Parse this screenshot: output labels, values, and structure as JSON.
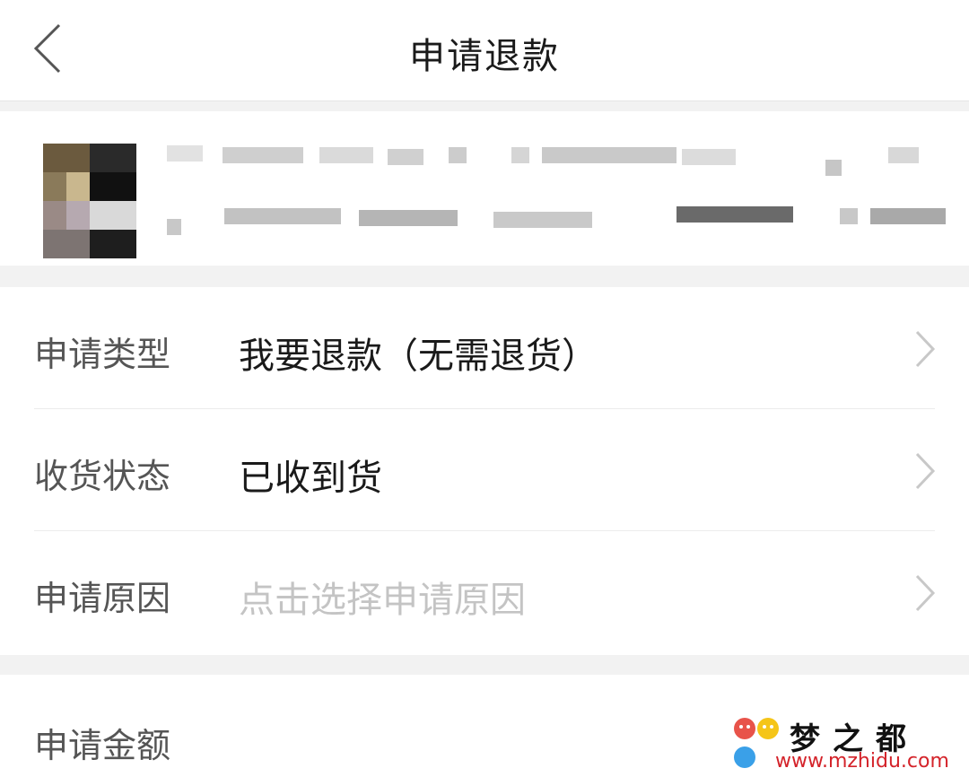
{
  "header": {
    "title": "申请退款"
  },
  "form": {
    "rows": [
      {
        "label": "申请类型",
        "value": "我要退款（无需退货）",
        "is_placeholder": false
      },
      {
        "label": "收货状态",
        "value": "已收到货",
        "is_placeholder": false
      },
      {
        "label": "申请原因",
        "value": "点击选择申请原因",
        "is_placeholder": true
      }
    ]
  },
  "amount": {
    "label": "申请金额"
  },
  "watermark": {
    "title": "梦之都",
    "url": "www.mzhidu.com"
  },
  "colors": {
    "background": "#f2f2f2",
    "card": "#ffffff",
    "label_text": "#555555",
    "value_text": "#1a1a1a",
    "placeholder_text": "#c4c4c4",
    "watermark_red": "#d4232a"
  }
}
